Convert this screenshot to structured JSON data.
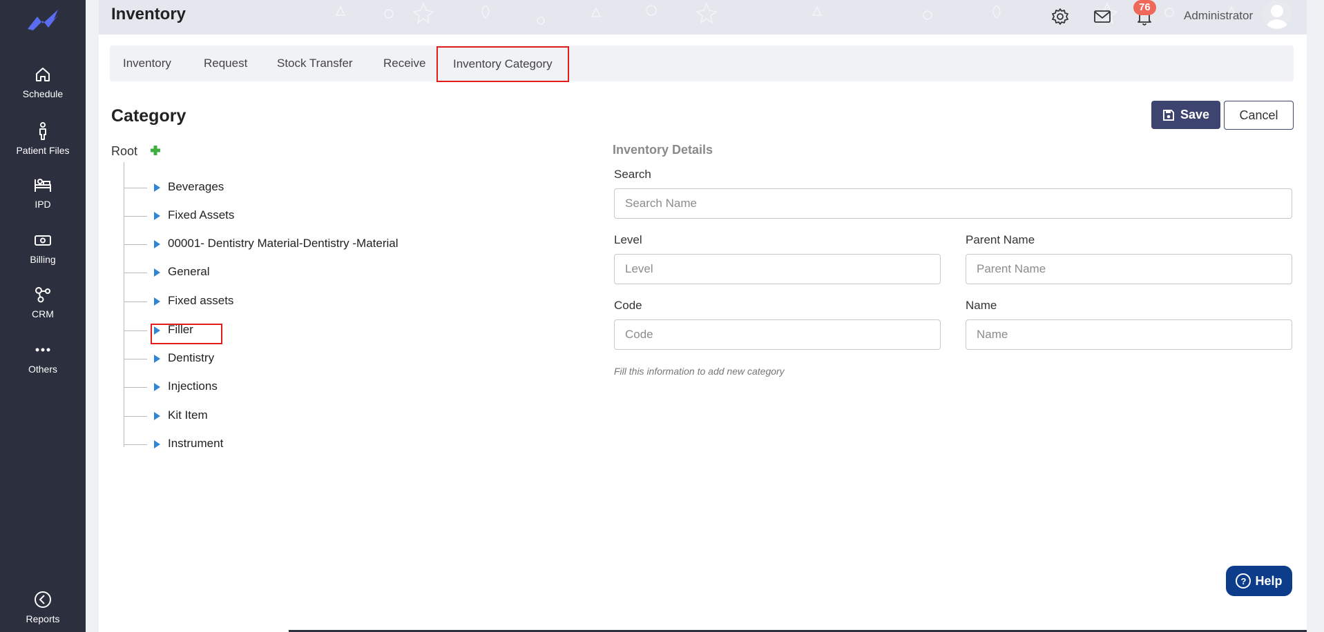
{
  "sidebar": {
    "items": [
      {
        "label": "Schedule",
        "icon": "home-icon"
      },
      {
        "label": "Patient Files",
        "icon": "person-icon"
      },
      {
        "label": "IPD",
        "icon": "bed-icon"
      },
      {
        "label": "Billing",
        "icon": "billing-icon"
      },
      {
        "label": "CRM",
        "icon": "crm-icon"
      },
      {
        "label": "Others",
        "icon": "dots-icon"
      },
      {
        "label": "Reports",
        "icon": "back-circle-icon"
      }
    ]
  },
  "header": {
    "title": "Inventory",
    "notification_count": "76",
    "user": "Administrator"
  },
  "tabs": [
    {
      "label": "Inventory"
    },
    {
      "label": "Request"
    },
    {
      "label": "Stock Transfer"
    },
    {
      "label": "Receive"
    },
    {
      "label": "Inventory Category"
    }
  ],
  "page": {
    "section_title": "Category",
    "save_label": "Save",
    "cancel_label": "Cancel"
  },
  "tree": {
    "root": "Root",
    "items": [
      {
        "label": "Beverages"
      },
      {
        "label": "Fixed Assets"
      },
      {
        "label": "00001- Dentistry Material-Dentistry -Material"
      },
      {
        "label": "General"
      },
      {
        "label": "Fixed assets"
      },
      {
        "label": "Filler"
      },
      {
        "label": "Dentistry"
      },
      {
        "label": "Injections"
      },
      {
        "label": "Kit Item"
      },
      {
        "label": "Instrument"
      }
    ]
  },
  "form": {
    "title": "Inventory Details",
    "search": {
      "label": "Search",
      "placeholder": "Search Name"
    },
    "level": {
      "label": "Level",
      "placeholder": "Level"
    },
    "parent": {
      "label": "Parent Name",
      "placeholder": "Parent Name"
    },
    "code": {
      "label": "Code",
      "placeholder": "Code"
    },
    "name": {
      "label": "Name",
      "placeholder": "Name"
    },
    "hint": "Fill this information to add new category"
  },
  "help_label": "Help",
  "colors": {
    "sidebar": "#2b2f3e",
    "accent": "#3d4470",
    "highlight": "#e31b1b",
    "tree_arrow": "#2f86d6",
    "badge": "#f0685a",
    "help": "#0d3c8a"
  }
}
